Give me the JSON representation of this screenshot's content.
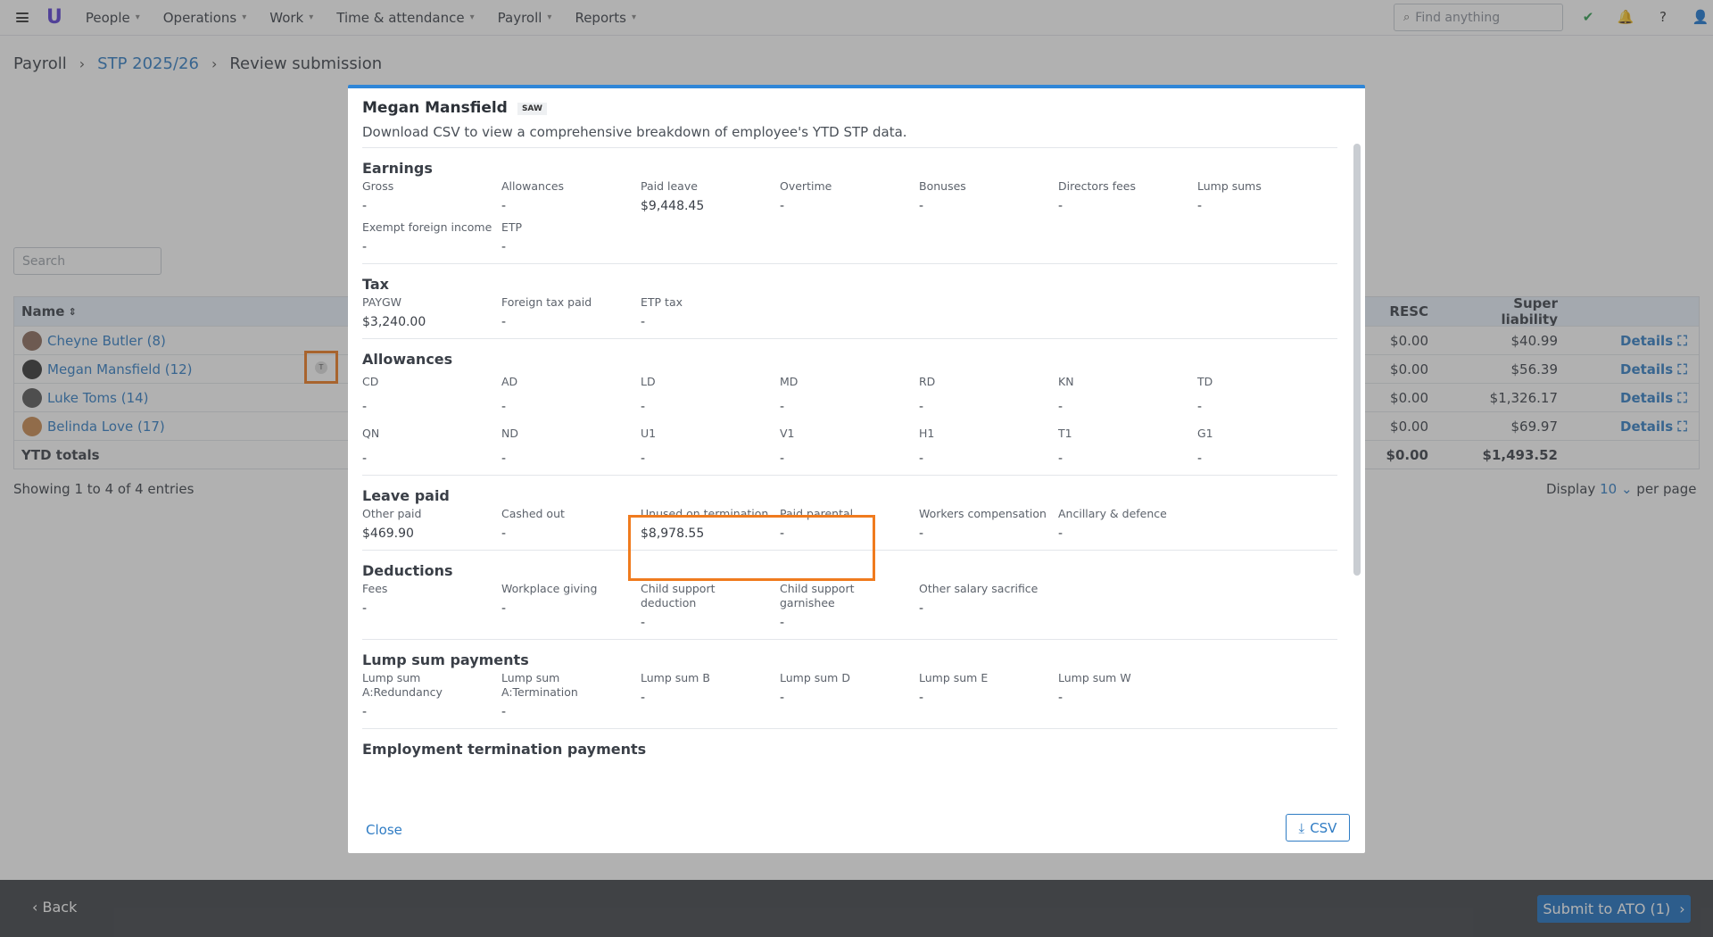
{
  "nav": {
    "items": [
      "People",
      "Operations",
      "Work",
      "Time & attendance",
      "Payroll",
      "Reports"
    ],
    "find_placeholder": "Find anything"
  },
  "breadcrumb": {
    "root": "Payroll",
    "link": "STP 2025/26",
    "current": "Review submission"
  },
  "background": {
    "search_placeholder": "Search",
    "headers": {
      "name": "Name",
      "resc": "RESC",
      "super": "Super liability"
    },
    "rows": [
      {
        "name": "Cheyne Butler (8)",
        "resc": "$0.00",
        "super": "$40.99",
        "details": "Details"
      },
      {
        "name": "Megan Mansfield (12)",
        "resc": "$0.00",
        "super": "$56.39",
        "details": "Details"
      },
      {
        "name": "Luke Toms (14)",
        "resc": "$0.00",
        "super": "$1,326.17",
        "details": "Details"
      },
      {
        "name": "Belinda Love (17)",
        "resc": "$0.00",
        "super": "$69.97",
        "details": "Details"
      }
    ],
    "totals": {
      "label": "YTD totals",
      "resc": "$0.00",
      "super": "$1,493.52"
    },
    "showing": "Showing 1 to 4 of 4 entries",
    "display_label": "Display",
    "display_value": "10",
    "per_page": "per page",
    "t_badge": "T"
  },
  "footer": {
    "back": "Back",
    "submit": "Submit to ATO (1)"
  },
  "modal": {
    "name": "Megan Mansfield",
    "tag": "SAW",
    "description": "Download CSV to view a comprehensive breakdown of employee's YTD STP data.",
    "sections": {
      "earnings": {
        "title": "Earnings",
        "fields": [
          {
            "label": "Gross",
            "value": "-"
          },
          {
            "label": "Allowances",
            "value": "-"
          },
          {
            "label": "Paid leave",
            "value": "$9,448.45"
          },
          {
            "label": "Overtime",
            "value": "-"
          },
          {
            "label": "Bonuses",
            "value": "-"
          },
          {
            "label": "Directors fees",
            "value": "-"
          },
          {
            "label": "Lump sums",
            "value": "-"
          },
          {
            "label": "Exempt foreign income",
            "value": "-"
          },
          {
            "label": "ETP",
            "value": "-"
          }
        ]
      },
      "tax": {
        "title": "Tax",
        "fields": [
          {
            "label": "PAYGW",
            "value": "$3,240.00"
          },
          {
            "label": "Foreign tax paid",
            "value": "-"
          },
          {
            "label": "ETP tax",
            "value": "-"
          }
        ]
      },
      "allowances": {
        "title": "Allowances",
        "fields": [
          {
            "label": "CD",
            "value": "-"
          },
          {
            "label": "AD",
            "value": "-"
          },
          {
            "label": "LD",
            "value": "-"
          },
          {
            "label": "MD",
            "value": "-"
          },
          {
            "label": "RD",
            "value": "-"
          },
          {
            "label": "KN",
            "value": "-"
          },
          {
            "label": "TD",
            "value": "-"
          },
          {
            "label": "QN",
            "value": "-"
          },
          {
            "label": "ND",
            "value": "-"
          },
          {
            "label": "U1",
            "value": "-"
          },
          {
            "label": "V1",
            "value": "-"
          },
          {
            "label": "H1",
            "value": "-"
          },
          {
            "label": "T1",
            "value": "-"
          },
          {
            "label": "G1",
            "value": "-"
          }
        ]
      },
      "leave": {
        "title": "Leave paid",
        "fields": [
          {
            "label": "Other paid",
            "value": "$469.90"
          },
          {
            "label": "Cashed out",
            "value": "-"
          },
          {
            "label": "Unused on termination",
            "value": "$8,978.55"
          },
          {
            "label": "Paid parental",
            "value": "-"
          },
          {
            "label": "Workers compensation",
            "value": "-"
          },
          {
            "label": "Ancillary & defence",
            "value": "-"
          }
        ]
      },
      "deductions": {
        "title": "Deductions",
        "fields": [
          {
            "label": "Fees",
            "value": "-"
          },
          {
            "label": "Workplace giving",
            "value": "-"
          },
          {
            "label": "Child support deduction",
            "value": "-"
          },
          {
            "label": "Child support garnishee",
            "value": "-"
          },
          {
            "label": "Other salary sacrifice",
            "value": "-"
          }
        ]
      },
      "lumpsum": {
        "title": "Lump sum payments",
        "fields": [
          {
            "label": "Lump sum A:Redundancy",
            "value": "-"
          },
          {
            "label": "Lump sum A:Termination",
            "value": "-"
          },
          {
            "label": "Lump sum B",
            "value": "-"
          },
          {
            "label": "Lump sum D",
            "value": "-"
          },
          {
            "label": "Lump sum E",
            "value": "-"
          },
          {
            "label": "Lump sum W",
            "value": "-"
          }
        ]
      },
      "etp": {
        "title": "Employment termination payments"
      }
    },
    "close": "Close",
    "csv": "CSV"
  },
  "colors": {
    "accent": "#2f7cc4",
    "highlight": "#f07b1e",
    "submit": "#1d6fc0"
  }
}
